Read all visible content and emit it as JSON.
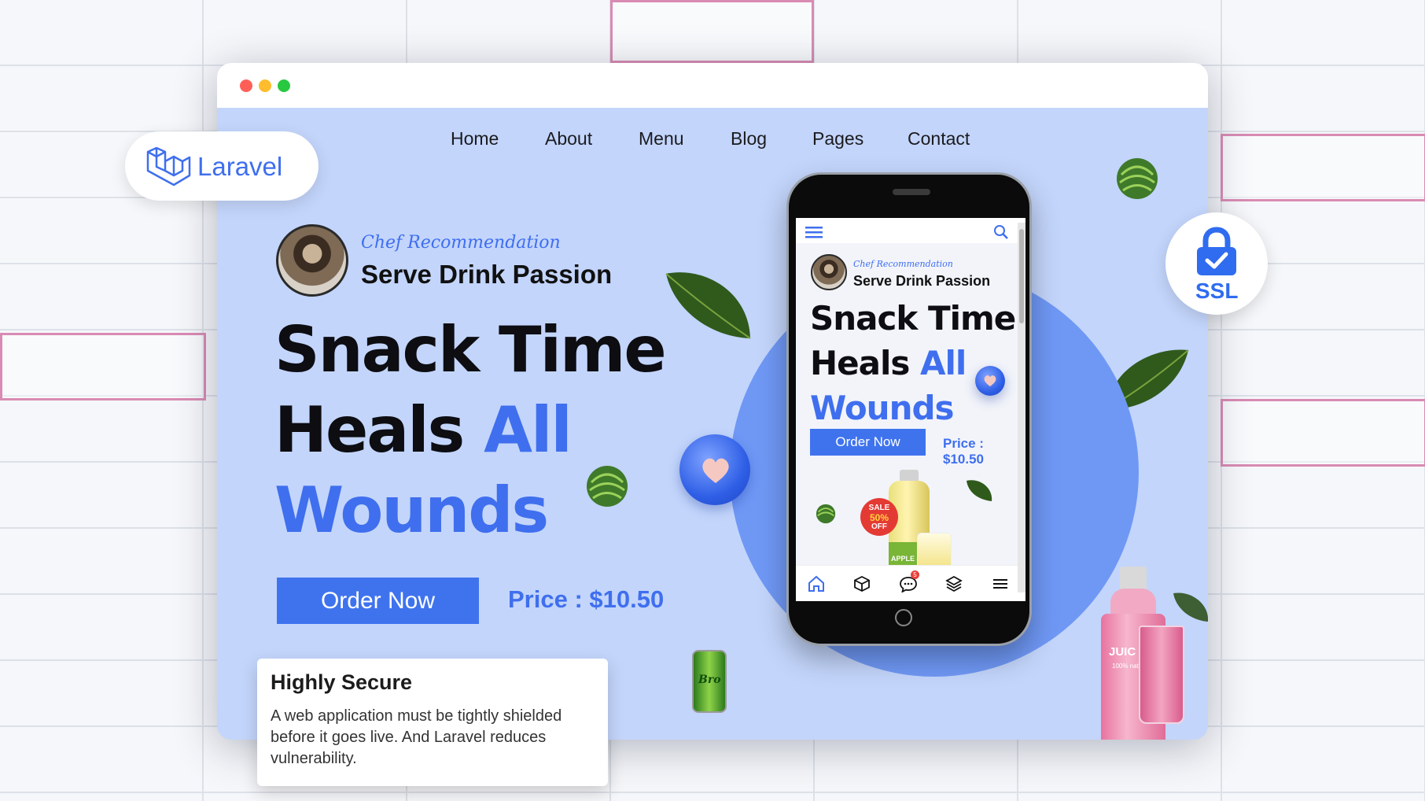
{
  "nav": [
    "Home",
    "About",
    "Menu",
    "Blog",
    "Pages",
    "Contact"
  ],
  "hero": {
    "tagline": "Chef Recommendation",
    "subtitle": "Serve Drink Passion",
    "title_line1": "Snack Time",
    "title_line2_a": "Heals ",
    "title_line2_b": "All",
    "title_line3": "Wounds",
    "order_label": "Order Now",
    "price": "Price : $10.50"
  },
  "mobile": {
    "tagline": "Chef Recommendation",
    "subtitle": "Serve Drink Passion",
    "title_line1": "Snack Time",
    "title_line2_a": "Heals ",
    "title_line2_b": "All",
    "title_line3": "Wounds",
    "order_label": "Order Now",
    "price": "Price : $10.50",
    "sale_line1": "SALE",
    "sale_line2": "50%",
    "sale_line3": "OFF",
    "product_label": "APPLE JU",
    "chat_badge": "5",
    "tabs": [
      "home-icon",
      "box-icon",
      "chat-icon",
      "layers-icon",
      "menu-icon"
    ]
  },
  "badges": {
    "laravel": "Laravel",
    "ssl": "SSL"
  },
  "juice_label": "JUIC",
  "juice_sub": "100% natural",
  "can_label": "Bro",
  "card": {
    "title": "Highly Secure",
    "body": "A web application must be tightly shielded before it goes live. And Laravel reduces vulnerability."
  },
  "colors": {
    "accent": "#3f6fee",
    "page_bg": "#c3d5fb",
    "heading": "#0d0d12"
  }
}
